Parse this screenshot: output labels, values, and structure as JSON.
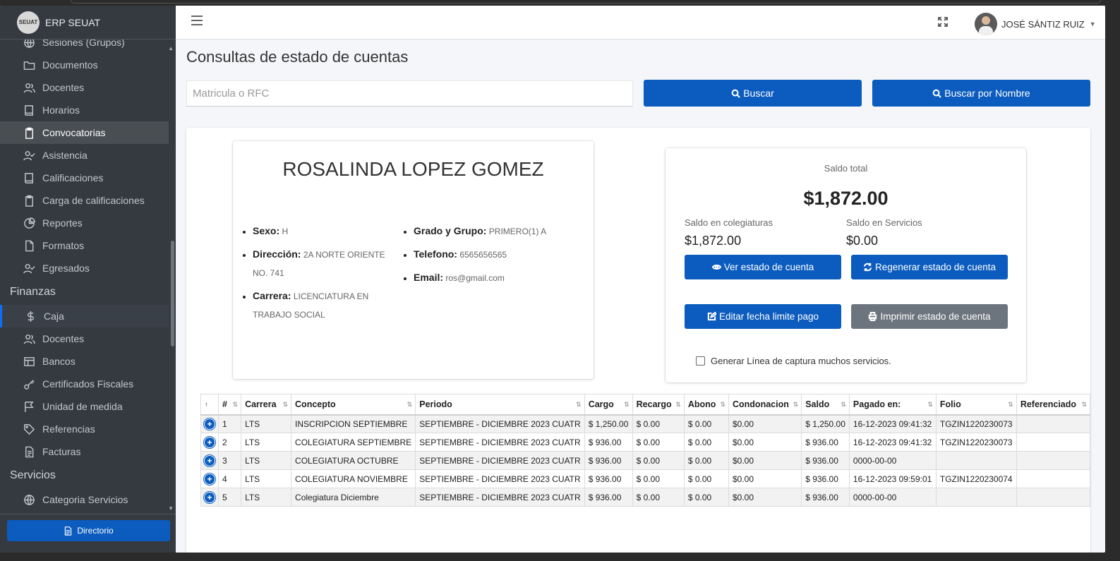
{
  "app": {
    "title": "ERP SEUAT",
    "logo_text": "SEUAT"
  },
  "sidebar": {
    "items_top": [
      {
        "label": "Sesiones (Grupos)",
        "icon": "globe-icon"
      },
      {
        "label": "Documentos",
        "icon": "folder-icon"
      },
      {
        "label": "Docentes",
        "icon": "users-icon"
      },
      {
        "label": "Horarios",
        "icon": "book-icon"
      },
      {
        "label": "Convocatorias",
        "icon": "clipboard-icon"
      },
      {
        "label": "Asistencia",
        "icon": "user-check-icon"
      },
      {
        "label": "Calificaciones",
        "icon": "book-icon"
      },
      {
        "label": "Carga de calificaciones",
        "icon": "clipboard-icon"
      },
      {
        "label": "Reportes",
        "icon": "pie-chart-icon"
      },
      {
        "label": "Formatos",
        "icon": "file-icon"
      },
      {
        "label": "Egresados",
        "icon": "user-check-icon"
      }
    ],
    "finanzas_header": "Finanzas",
    "finanzas_items": [
      {
        "label": "Caja",
        "icon": "dollar-icon"
      },
      {
        "label": "Docentes",
        "icon": "users-icon"
      },
      {
        "label": "Bancos",
        "icon": "table-icon"
      },
      {
        "label": "Certificados Fiscales",
        "icon": "key-icon"
      },
      {
        "label": "Unidad de medida",
        "icon": "flag-icon"
      },
      {
        "label": "Referencias",
        "icon": "tag-icon"
      },
      {
        "label": "Facturas",
        "icon": "file-text-icon"
      }
    ],
    "servicios_header": "Servicios",
    "servicios_items": [
      {
        "label": "Categoria Servicios",
        "icon": "globe-icon"
      }
    ],
    "directorio_label": "Directorio"
  },
  "topbar": {
    "user_name": "JOSÉ SÁNTIZ RUIZ"
  },
  "page": {
    "title": "Consultas de estado de cuentas",
    "search_placeholder": "Matricula o RFC",
    "buscar_label": "Buscar",
    "buscar_nombre_label": "Buscar por Nombre"
  },
  "student": {
    "name": "ROSALINDA LOPEZ GOMEZ",
    "sexo_label": "Sexo:",
    "sexo": "H",
    "direccion_label": "Dirección:",
    "direccion": "2A NORTE ORIENTE NO. 741",
    "carrera_label": "Carrera:",
    "carrera": "LICENCIATURA EN TRABAJO SOCIAL",
    "grado_label": "Grado y Grupo:",
    "grado": "PRIMERO(1) A",
    "telefono_label": "Telefono:",
    "telefono": "6565656565",
    "email_label": "Email:",
    "email": "ros@gmail.com"
  },
  "saldo": {
    "total_label": "Saldo total",
    "total": "$1,872.00",
    "colegiaturas_label": "Saldo en colegiaturas",
    "colegiaturas": "$1,872.00",
    "servicios_label": "Saldo en Servicios",
    "servicios": "$0.00",
    "ver_label": "Ver estado de cuenta",
    "regenerar_label": "Regenerar estado de cuenta",
    "editar_label": "Editar fecha limite pago",
    "imprimir_label": "Imprimir estado de cuenta",
    "checkbox_label": "Generar Línea de captura muchos servicios."
  },
  "table": {
    "headers": [
      "",
      "#",
      "Carrera",
      "Concepto",
      "Periodo",
      "Cargo",
      "Recargo",
      "Abono",
      "Condonacion",
      "Saldo",
      "Pagado en:",
      "Folio",
      "Referenciado"
    ],
    "rows": [
      [
        "1",
        "LTS",
        "INSCRIPCION SEPTIEMBRE",
        "SEPTIEMBRE - DICIEMBRE 2023 CUATR",
        "$ 1,250.00",
        "$ 0.00",
        "$ 0.00",
        "$0.00",
        "$ 1,250.00",
        "16-12-2023 09:41:32",
        "TGZIN1220230073",
        ""
      ],
      [
        "2",
        "LTS",
        "COLEGIATURA SEPTIEMBRE",
        "SEPTIEMBRE - DICIEMBRE 2023 CUATR",
        "$ 936.00",
        "$ 0.00",
        "$ 0.00",
        "$0.00",
        "$ 936.00",
        "16-12-2023 09:41:32",
        "TGZIN1220230073",
        ""
      ],
      [
        "3",
        "LTS",
        "COLEGIATURA OCTUBRE",
        "SEPTIEMBRE - DICIEMBRE 2023 CUATR",
        "$ 936.00",
        "$ 0.00",
        "$ 0.00",
        "$0.00",
        "$ 936.00",
        "0000-00-00",
        "",
        ""
      ],
      [
        "4",
        "LTS",
        "COLEGIATURA NOVIEMBRE",
        "SEPTIEMBRE - DICIEMBRE 2023 CUATR",
        "$ 936.00",
        "$ 0.00",
        "$ 0.00",
        "$0.00",
        "$ 936.00",
        "16-12-2023 09:59:01",
        "TGZIN1220230074",
        ""
      ],
      [
        "5",
        "LTS",
        "Colegiatura Diciembre",
        "SEPTIEMBRE - DICIEMBRE 2023 CUATR",
        "$ 936.00",
        "$ 0.00",
        "$ 0.00",
        "$0.00",
        "$ 936.00",
        "0000-00-00",
        "",
        ""
      ]
    ]
  },
  "colors": {
    "primary": "#0b5cbe",
    "sidebar_bg": "#343a40",
    "gray_button": "#6c757d"
  }
}
